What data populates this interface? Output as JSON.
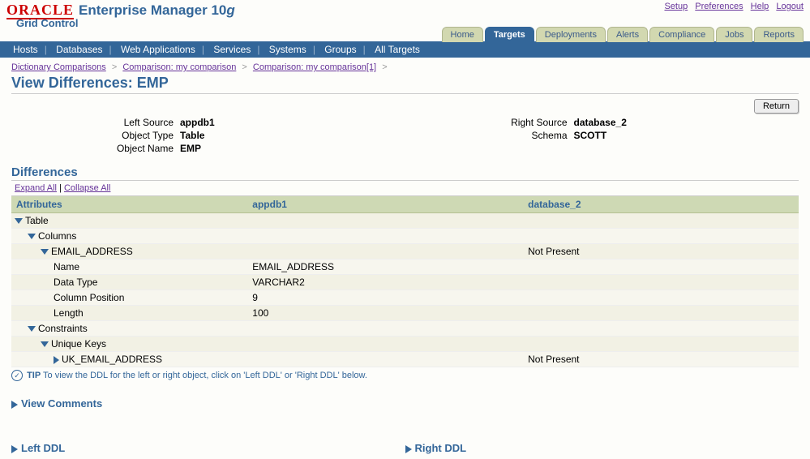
{
  "header": {
    "oracle": "ORACLE",
    "product": "Enterprise Manager 10",
    "product_suffix": "g",
    "grid_control": "Grid Control",
    "top_links": [
      "Setup",
      "Preferences",
      "Help",
      "Logout"
    ]
  },
  "tabs": [
    "Home",
    "Targets",
    "Deployments",
    "Alerts",
    "Compliance",
    "Jobs",
    "Reports"
  ],
  "active_tab": "Targets",
  "subnav": [
    "Hosts",
    "Databases",
    "Web Applications",
    "Services",
    "Systems",
    "Groups",
    "All Targets"
  ],
  "breadcrumb": [
    {
      "label": "Dictionary Comparisons",
      "link": true
    },
    {
      "label": "Comparison: my comparison",
      "link": true
    },
    {
      "label": "Comparison: my comparison[1]",
      "link": true
    }
  ],
  "page_title": "View Differences: EMP",
  "return_label": "Return",
  "sources": {
    "left_label": "Left Source",
    "left_val": "appdb1",
    "right_label": "Right Source",
    "right_val": "database_2",
    "objtype_label": "Object Type",
    "objtype_val": "Table",
    "schema_label": "Schema",
    "schema_val": "SCOTT",
    "objname_label": "Object Name",
    "objname_val": "EMP"
  },
  "differences_title": "Differences",
  "expand_all": "Expand All",
  "collapse_all": "Collapse All",
  "col_headers": {
    "attr": "Attributes",
    "left": "appdb1",
    "right": "database_2"
  },
  "rows": [
    {
      "label": "Table",
      "left": "",
      "right": "",
      "indent": 0,
      "toggle": "down"
    },
    {
      "label": "Columns",
      "left": "",
      "right": "",
      "indent": 1,
      "toggle": "down"
    },
    {
      "label": "EMAIL_ADDRESS",
      "left": "",
      "right": "Not Present",
      "indent": 2,
      "toggle": "down"
    },
    {
      "label": "Name",
      "left": "EMAIL_ADDRESS",
      "right": "",
      "indent": 3
    },
    {
      "label": "Data Type",
      "left": "VARCHAR2",
      "right": "",
      "indent": 3
    },
    {
      "label": "Column Position",
      "left": "9",
      "right": "",
      "indent": 3
    },
    {
      "label": "Length",
      "left": "100",
      "right": "",
      "indent": 3
    },
    {
      "label": "Constraints",
      "left": "",
      "right": "",
      "indent": 1,
      "toggle": "down"
    },
    {
      "label": "Unique Keys",
      "left": "",
      "right": "",
      "indent": 2,
      "toggle": "down"
    },
    {
      "label": "UK_EMAIL_ADDRESS",
      "left": "",
      "right": "Not Present",
      "indent": 2,
      "toggle": "right",
      "extra_indent": true
    }
  ],
  "tip_label": "TIP",
  "tip_text": "To view the DDL for the left or right object, click on 'Left DDL' or 'Right DDL' below.",
  "view_comments": "View Comments",
  "left_ddl": "Left DDL",
  "right_ddl": "Right DDL"
}
